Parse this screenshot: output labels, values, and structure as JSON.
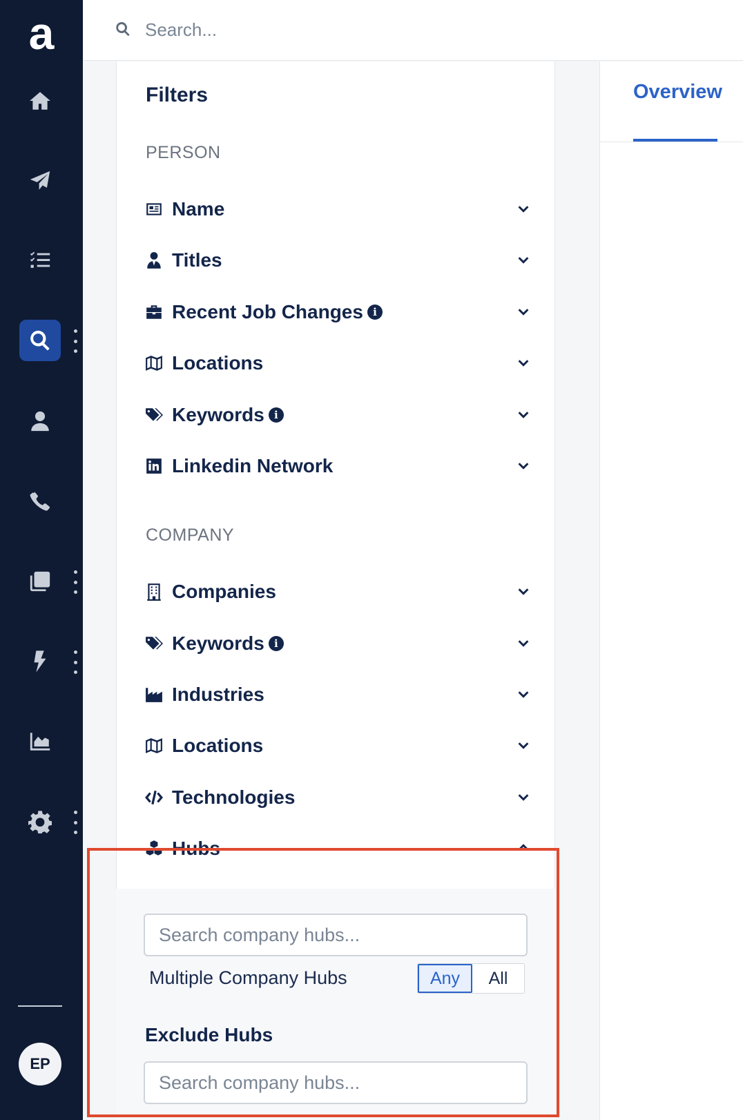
{
  "nav": {
    "logo": "a",
    "avatar_initials": "EP"
  },
  "search": {
    "placeholder": "Search..."
  },
  "filters": {
    "title": "Filters",
    "person_section": "PERSON",
    "person_items": [
      {
        "label": "Name",
        "icon": "id-card-icon"
      },
      {
        "label": "Titles",
        "icon": "user-tie-icon"
      },
      {
        "label": "Recent Job Changes",
        "icon": "briefcase-icon",
        "info": true
      },
      {
        "label": "Locations",
        "icon": "map-icon"
      },
      {
        "label": "Keywords",
        "icon": "tags-icon",
        "info": true
      },
      {
        "label": "Linkedin Network",
        "icon": "linkedin-icon"
      }
    ],
    "company_section": "COMPANY",
    "company_items": [
      {
        "label": "Companies",
        "icon": "building-icon"
      },
      {
        "label": "Keywords",
        "icon": "tags-icon",
        "info": true
      },
      {
        "label": "Industries",
        "icon": "industry-icon"
      },
      {
        "label": "Locations",
        "icon": "map-icon"
      },
      {
        "label": "Technologies",
        "icon": "code-icon"
      },
      {
        "label": "Hubs",
        "icon": "cubes-icon",
        "expanded": true
      }
    ],
    "info_glyph": "i"
  },
  "hubs": {
    "search_placeholder": "Search company hubs...",
    "multiple_label": "Multiple Company Hubs",
    "toggle_any": "Any",
    "toggle_all": "All",
    "selected": "Any",
    "exclude_label": "Exclude Hubs",
    "exclude_placeholder": "Search company hubs..."
  },
  "right_panel": {
    "tab_label": "Overview"
  },
  "colors": {
    "nav_bg": "#0f1b33",
    "accent": "#2b63c9",
    "highlight": "#e04a2f"
  }
}
